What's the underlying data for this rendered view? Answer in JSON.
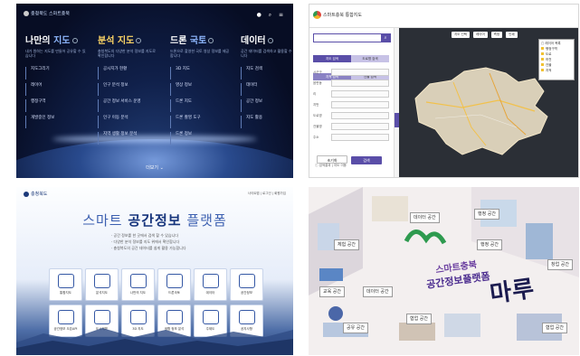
{
  "panel1": {
    "logo": "충청북도 스마트충북",
    "top_icons": "● ⌕ ≡",
    "columns": [
      {
        "title_a": "나만의",
        "title_b": "지도",
        "desc": "내가 원하는 지도를 만들어 공유할 수 있습니다",
        "items": [
          "지도그리기",
          "레이어",
          "행정구역",
          "개발중인 정보"
        ]
      },
      {
        "title_a": "분석",
        "title_b": "지도",
        "desc": "충청북도의 다양한 분석 정보를 지도로 확인합니다",
        "items": [
          "공시지가 현황",
          "인구 분석 정보",
          "공간 정보 서비스 운영",
          "인구 이동 분석",
          "지역 생활 정보 분석"
        ]
      },
      {
        "title_a": "드론",
        "title_b": "국토",
        "desc": "드론으로 촬영한 국토 영상 정보를 제공합니다",
        "items": [
          "3D 지도",
          "영상 정보",
          "드론 지도",
          "드론 촬영 도구",
          "드론 정보"
        ]
      },
      {
        "title_a": "데이터",
        "title_b": "",
        "desc": "공간 데이터를 검색하고 활용할 수 있습니다",
        "items": [
          "지도 검색",
          "데이터",
          "공간 정보",
          "지도 활용"
        ]
      }
    ],
    "bottom": "더보기 ⌄"
  },
  "panel2": {
    "logo": "스마트충북 통합지도",
    "search_placeholder": "",
    "tabs": [
      "지도 검색",
      "도로명 검색",
      "지적 검색",
      "건물 검색"
    ],
    "form_labels": [
      "시군구",
      "읍면동",
      "리",
      "지번",
      "도로명",
      "건물명",
      "주소",
      "검색"
    ],
    "actions": [
      "초기화",
      "검색"
    ],
    "sidefoot": "ⓘ 검색결과 | 지도 이동",
    "map_tools": [
      "지도 선택",
      "레이어",
      "측정",
      "인쇄"
    ],
    "layers": [
      "▢ 레이어 목록",
      "행정구역",
      "도로",
      "하천",
      "건물",
      "지적"
    ]
  },
  "panel3": {
    "logo": "충청북도",
    "top_right": "사이트맵 | 로그인 | 회원가입",
    "title_a": "스마트",
    "title_b": "공간정보",
    "title_c": "플랫폼",
    "bullets": [
      "· 공간 정보를 한 곳에서 검색 할 수 있습니다",
      "· 다양한 분석 정보를 지도 위에서 확인합니다",
      "· 충청북도의 공간 데이터를 쉽게 활용 가능합니다"
    ],
    "cards": [
      "통합지도",
      "분석지도",
      "나만의 지도",
      "드론국토",
      "데이터",
      "공간정보",
      "공간정보 오픈API",
      "도시계획",
      "3D 지도",
      "생활 정보 분석",
      "주제도",
      "공지사항"
    ]
  },
  "panel4": {
    "title_small": "스마트충북",
    "title_mid": "공간정보플랫폼",
    "title_big": "마루",
    "labels": [
      "데이터 공간",
      "행정 공간",
      "행정 공간",
      "체험 공간",
      "교육 공간",
      "데이터 공간",
      "협업 공간",
      "창업 공간",
      "협업 공간",
      "공유 공간"
    ]
  }
}
